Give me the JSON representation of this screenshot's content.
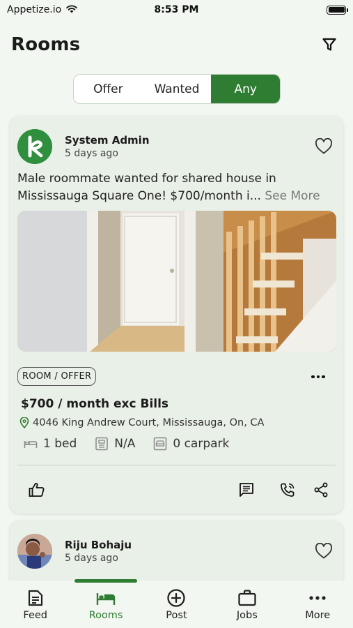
{
  "status_bar": {
    "carrier": "Appetize.io",
    "time": "8:53 PM"
  },
  "header": {
    "title": "Rooms"
  },
  "segments": [
    {
      "label": "Offer"
    },
    {
      "label": "Wanted"
    },
    {
      "label": "Any",
      "active": true
    }
  ],
  "posts": [
    {
      "author": "System Admin",
      "time": "5 days ago",
      "description": "Male roommate wanted for shared house in Mississauga Square One! $700/month i...",
      "see_more": "See More",
      "tag": "ROOM / OFFER",
      "price": "$700 / month exc Bills",
      "address": "4046 King Andrew Court, Mississauga, On, CA",
      "bed": "1 bed",
      "bath": "N/A",
      "carpark": "0 carpark"
    },
    {
      "author": "Riju Bohaju",
      "time": "5 days ago"
    }
  ],
  "nav": [
    {
      "label": "Feed",
      "icon": "feed-icon"
    },
    {
      "label": "Rooms",
      "icon": "bed-icon",
      "active": true
    },
    {
      "label": "Post",
      "icon": "plus-circle-icon"
    },
    {
      "label": "Jobs",
      "icon": "briefcase-icon"
    },
    {
      "label": "More",
      "icon": "more-icon"
    }
  ],
  "colors": {
    "accent": "#2f7d32",
    "background": "#f3f7f1",
    "card": "#e9f0e7"
  }
}
